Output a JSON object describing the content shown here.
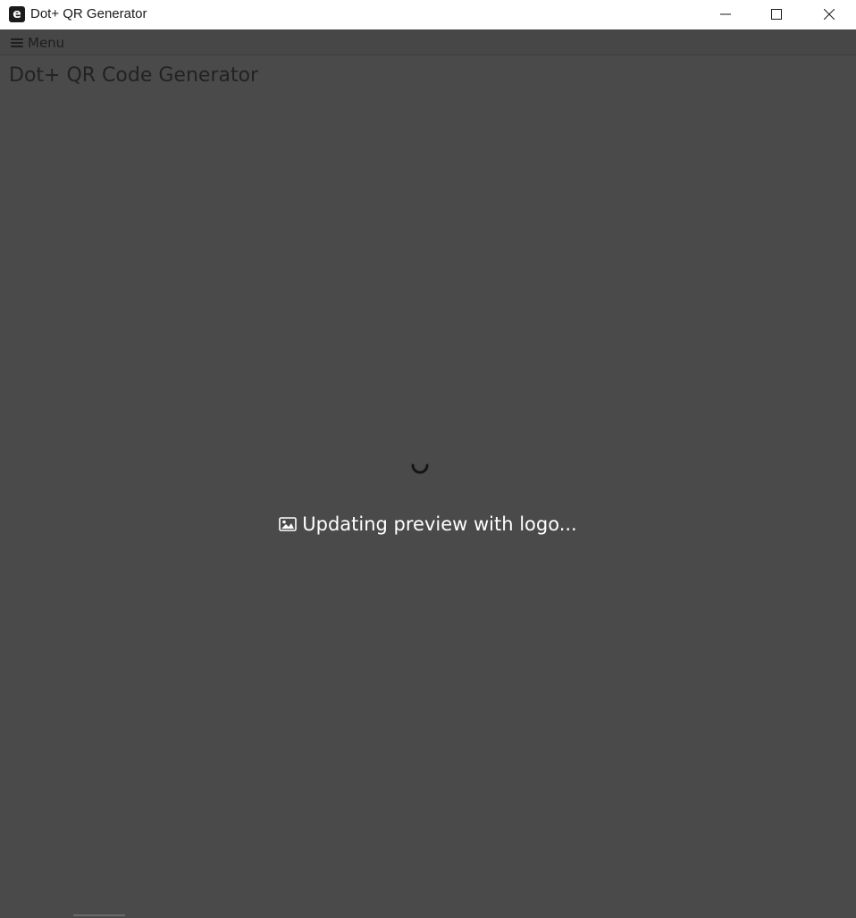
{
  "window": {
    "app_icon_letter": "e",
    "title": "Dot+ QR Generator",
    "controls": {
      "minimize_icon": "minimize-icon",
      "maximize_icon": "maximize-icon",
      "close_icon": "close-icon"
    }
  },
  "menubar": {
    "menu_label": "Menu",
    "menu_icon": "hamburger-icon"
  },
  "main": {
    "page_title": "Dot+ QR Code Generator",
    "loading": {
      "spinner_icon": "spinner-icon",
      "message_icon": "image-icon",
      "message": "Updating preview with logo..."
    }
  },
  "colors": {
    "background": "#4a4a4a",
    "titlebar": "#ffffff",
    "loading_text": "#ffffff"
  }
}
